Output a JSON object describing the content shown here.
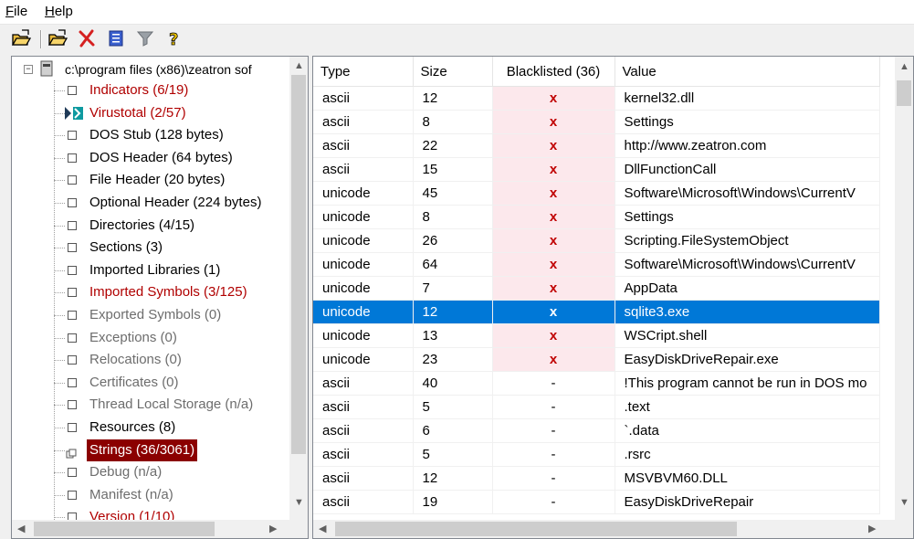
{
  "menu": {
    "file": {
      "u": "F",
      "rest": "ile"
    },
    "help": {
      "u": "H",
      "rest": "elp"
    }
  },
  "toolbar": {
    "buttons": [
      "open-file-icon",
      "open-folder-icon",
      "remove-icon",
      "save-report-icon",
      "filter-icon",
      "about-icon"
    ]
  },
  "tree": {
    "root": "c:\\program files (x86)\\zeatron sof",
    "items": [
      {
        "label": "Indicators (6/19)",
        "color": "red"
      },
      {
        "label": "Virustotal (2/57)",
        "color": "red",
        "icon": "virustotal-icon"
      },
      {
        "label": "DOS Stub (128 bytes)",
        "color": "black"
      },
      {
        "label": "DOS Header (64 bytes)",
        "color": "black"
      },
      {
        "label": "File Header (20 bytes)",
        "color": "black"
      },
      {
        "label": "Optional Header (224 bytes)",
        "color": "black"
      },
      {
        "label": "Directories (4/15)",
        "color": "black"
      },
      {
        "label": "Sections (3)",
        "color": "black"
      },
      {
        "label": "Imported Libraries (1)",
        "color": "black"
      },
      {
        "label": "Imported Symbols (3/125)",
        "color": "red"
      },
      {
        "label": "Exported Symbols (0)",
        "color": "gray"
      },
      {
        "label": "Exceptions (0)",
        "color": "gray"
      },
      {
        "label": "Relocations (0)",
        "color": "gray"
      },
      {
        "label": "Certificates (0)",
        "color": "gray"
      },
      {
        "label": "Thread Local Storage (n/a)",
        "color": "gray"
      },
      {
        "label": "Resources (8)",
        "color": "black"
      },
      {
        "label": "Strings (36/3061)",
        "color": "selected"
      },
      {
        "label": "Debug (n/a)",
        "color": "gray"
      },
      {
        "label": "Manifest (n/a)",
        "color": "gray"
      },
      {
        "label": "Version (1/10)",
        "color": "red"
      }
    ]
  },
  "table": {
    "headers": [
      "Type",
      "Size",
      "Blacklisted (36)",
      "Value"
    ],
    "rows": [
      {
        "type": "ascii",
        "size": "12",
        "bl": "x",
        "value": "kernel32.dll"
      },
      {
        "type": "ascii",
        "size": "8",
        "bl": "x",
        "value": "Settings"
      },
      {
        "type": "ascii",
        "size": "22",
        "bl": "x",
        "value": "http://www.zeatron.com"
      },
      {
        "type": "ascii",
        "size": "15",
        "bl": "x",
        "value": "DllFunctionCall"
      },
      {
        "type": "unicode",
        "size": "45",
        "bl": "x",
        "value": "Software\\Microsoft\\Windows\\CurrentV"
      },
      {
        "type": "unicode",
        "size": "8",
        "bl": "x",
        "value": "Settings"
      },
      {
        "type": "unicode",
        "size": "26",
        "bl": "x",
        "value": "Scripting.FileSystemObject"
      },
      {
        "type": "unicode",
        "size": "64",
        "bl": "x",
        "value": "Software\\Microsoft\\Windows\\CurrentV"
      },
      {
        "type": "unicode",
        "size": "7",
        "bl": "x",
        "value": "AppData"
      },
      {
        "type": "unicode",
        "size": "12",
        "bl": "x",
        "value": "sqlite3.exe",
        "selected": true
      },
      {
        "type": "unicode",
        "size": "13",
        "bl": "x",
        "value": "WSCript.shell"
      },
      {
        "type": "unicode",
        "size": "23",
        "bl": "x",
        "value": "EasyDiskDriveRepair.exe"
      },
      {
        "type": "ascii",
        "size": "40",
        "bl": "-",
        "value": "!This program cannot be run in DOS mo"
      },
      {
        "type": "ascii",
        "size": "5",
        "bl": "-",
        "value": ".text"
      },
      {
        "type": "ascii",
        "size": "6",
        "bl": "-",
        "value": "`.data"
      },
      {
        "type": "ascii",
        "size": "5",
        "bl": "-",
        "value": ".rsrc"
      },
      {
        "type": "ascii",
        "size": "12",
        "bl": "-",
        "value": "MSVBVM60.DLL"
      },
      {
        "type": "ascii",
        "size": "19",
        "bl": "-",
        "value": "EasyDiskDriveRepair"
      }
    ]
  },
  "colors": {
    "selection": "#0078d7",
    "blacklist_bg": "#fce8ec",
    "red_text": "#b00000",
    "strings_selected_bg": "#8b0000"
  }
}
